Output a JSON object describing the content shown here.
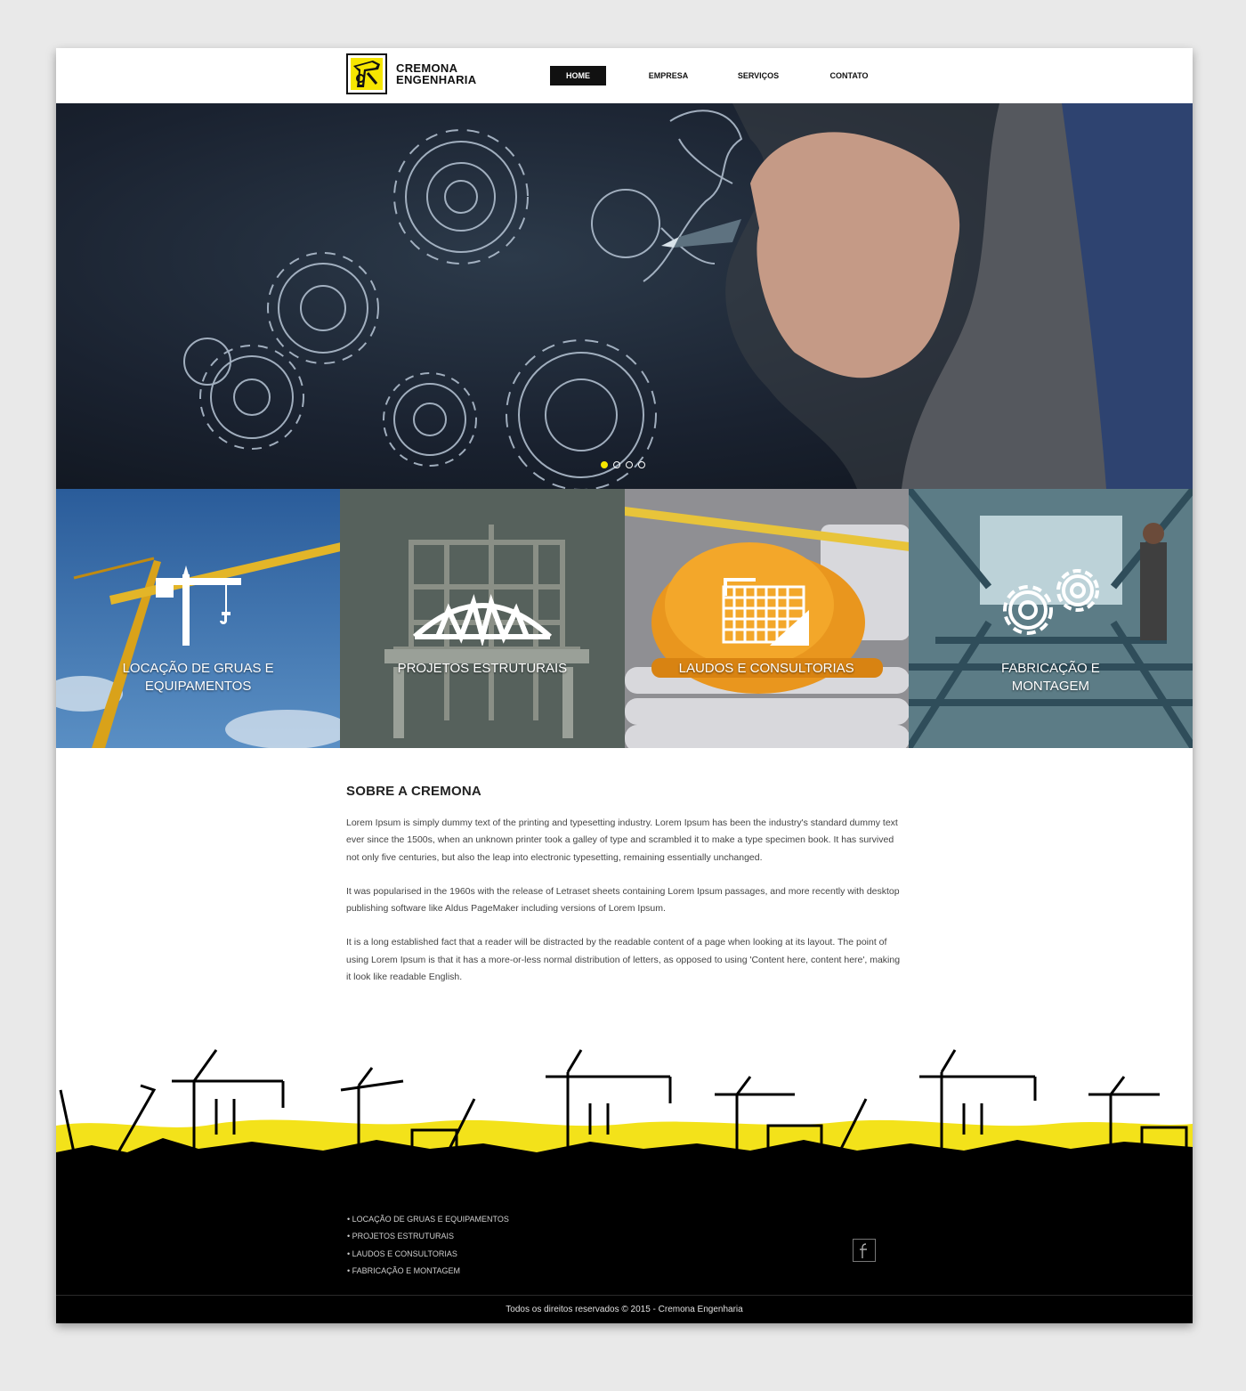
{
  "brand": {
    "name_line1": "CREMONA",
    "name_line2": "ENGENHARIA",
    "logo_icon": "crane-hook-logo",
    "accent": "#f6e600"
  },
  "nav": {
    "items": [
      {
        "label": "HOME",
        "active": true
      },
      {
        "label": "EMPRESA",
        "active": false
      },
      {
        "label": "SERVIÇOS",
        "active": false
      },
      {
        "label": "CONTATO",
        "active": false
      }
    ]
  },
  "hero": {
    "slides_total": 4,
    "active_slide": 1
  },
  "services": [
    {
      "label": "LOCAÇÃO DE GRUAS E EQUIPAMENTOS",
      "icon": "tower-crane-icon"
    },
    {
      "label": "PROJETOS ESTRUTURAIS",
      "icon": "truss-bridge-icon"
    },
    {
      "label": "LAUDOS E CONSULTORIAS",
      "icon": "blueprint-set-square-icon"
    },
    {
      "label": "FABRICAÇÃO E MONTAGEM",
      "icon": "gears-icon"
    }
  ],
  "about": {
    "title": "SOBRE A CREMONA",
    "paragraphs": [
      "Lorem Ipsum is simply dummy text of the printing and typesetting industry. Lorem Ipsum has been the industry's standard dummy text ever since the 1500s, when an unknown printer took a galley of type and scrambled it to make a type specimen book. It has survived not only five centuries, but also the leap into electronic typesetting, remaining essentially unchanged.",
      "It was popularised in the 1960s with the release of Letraset sheets containing Lorem Ipsum passages, and more recently with desktop publishing software like Aldus PageMaker including versions of Lorem Ipsum.",
      "It is a long established fact that a reader will be distracted by the readable content of a page when looking at its layout. The point of using Lorem Ipsum is that it has a more-or-less normal distribution of letters, as opposed to using 'Content here, content here', making it look like readable English."
    ]
  },
  "footer": {
    "links": [
      "• LOCAÇÃO DE GRUAS E EQUIPAMENTOS",
      "• PROJETOS ESTRUTURAIS",
      "• LAUDOS E CONSULTORIAS",
      "• FABRICAÇÃO E MONTAGEM"
    ],
    "social_icon": "facebook-icon",
    "copyright": "Todos os direitos reservados © 2015 - Cremona Engenharia"
  }
}
